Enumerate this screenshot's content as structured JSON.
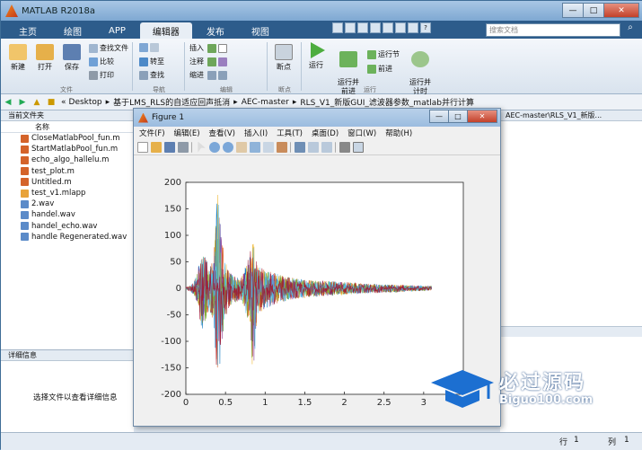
{
  "app": {
    "title": "MATLAB R2018a"
  },
  "window_buttons": {
    "minimize": "—",
    "maximize": "□",
    "close": "✕"
  },
  "tabs": [
    "主页",
    "绘图",
    "APP",
    "编辑器",
    "发布",
    "视图"
  ],
  "active_tab": "编辑器",
  "search": {
    "placeholder": "搜索文档"
  },
  "ribbon": {
    "file_group": {
      "label": "文件",
      "new": "新建",
      "open": "打开",
      "save": "保存",
      "find_files": "查找文件",
      "compare": "比较",
      "print": "打印"
    },
    "nav_group": {
      "label": "导航",
      "goto": "转至",
      "find": "查找"
    },
    "edit_group": {
      "label": "编辑",
      "insert": "插入",
      "comment": "注释",
      "indent": "缩进"
    },
    "breakpoint_group": {
      "label": "断点",
      "breakpoints": "断点"
    },
    "run_group": {
      "label": "运行",
      "run": "运行",
      "run_advance": "运行并\n前进",
      "run_section": "运行节",
      "advance": "前进",
      "run_time": "运行并\n计时"
    }
  },
  "address": {
    "path": [
      "«",
      "Desktop",
      "基于LMS_RLS的自适应回声抵消",
      "AEC-master",
      "RLS_V1_新版GUI_滤波器参数_matlab并行计算"
    ],
    "right_path": "AEC-master\\RLS_V1_新版..."
  },
  "current_folder": {
    "title": "当前文件夹",
    "column": "名称",
    "files": [
      {
        "name": "CloseMatlabPool_fun.m",
        "type": "m"
      },
      {
        "name": "StartMatlabPool_fun.m",
        "type": "m"
      },
      {
        "name": "echo_algo_hallelu.m",
        "type": "m"
      },
      {
        "name": "test_plot.m",
        "type": "m"
      },
      {
        "name": "Untitled.m",
        "type": "m"
      },
      {
        "name": "test_v1.mlapp",
        "type": "app"
      },
      {
        "name": "2.wav",
        "type": "wav"
      },
      {
        "name": "handel.wav",
        "type": "wav"
      },
      {
        "name": "handel_echo.wav",
        "type": "wav"
      },
      {
        "name": "handle Regenerated.wav",
        "type": "wav"
      }
    ]
  },
  "details": {
    "title": "详细信息",
    "message": "选择文件以查看详细信息"
  },
  "figure": {
    "title": "Figure 1",
    "menu": [
      "文件(F)",
      "编辑(E)",
      "查看(V)",
      "插入(I)",
      "工具(T)",
      "桌面(D)",
      "窗口(W)",
      "帮助(H)"
    ]
  },
  "chart_data": {
    "type": "line",
    "title": "",
    "xlabel": "",
    "ylabel": "",
    "xlim": [
      0,
      3.5
    ],
    "ylim": [
      -200,
      200
    ],
    "xticks": [
      0,
      0.5,
      1,
      1.5,
      2,
      2.5,
      3
    ],
    "yticks": [
      200,
      150,
      100,
      50,
      0,
      -50,
      -100,
      -150,
      -200
    ],
    "grid": false,
    "colors": [
      "#0072bd",
      "#d95319",
      "#edb120",
      "#7e2f8e",
      "#77ac30",
      "#4dbeee",
      "#a2142f"
    ],
    "envelope": {
      "x": [
        0.0,
        0.05,
        0.1,
        0.15,
        0.2,
        0.25,
        0.3,
        0.35,
        0.4,
        0.45,
        0.5,
        0.55,
        0.6,
        0.7,
        0.8,
        0.85,
        0.9,
        1.0,
        1.2,
        1.4,
        1.6,
        1.8,
        2.0,
        2.2,
        2.4,
        2.6,
        2.8,
        3.0,
        3.1
      ],
      "max": [
        2,
        5,
        12,
        35,
        70,
        60,
        40,
        55,
        190,
        110,
        50,
        30,
        25,
        20,
        60,
        95,
        45,
        35,
        25,
        18,
        15,
        14,
        12,
        10,
        8,
        7,
        6,
        5,
        4
      ],
      "min": [
        -2,
        -5,
        -12,
        -35,
        -80,
        -60,
        -45,
        -70,
        -180,
        -120,
        -55,
        -35,
        -28,
        -22,
        -70,
        -170,
        -50,
        -38,
        -26,
        -20,
        -16,
        -14,
        -12,
        -10,
        -9,
        -8,
        -6,
        -5,
        -4
      ]
    }
  },
  "status": {
    "row_label": "行",
    "row": "1",
    "col_label": "列",
    "col": "1"
  },
  "watermark": {
    "line1": "必过源码",
    "line2": "Biguo100.com"
  }
}
